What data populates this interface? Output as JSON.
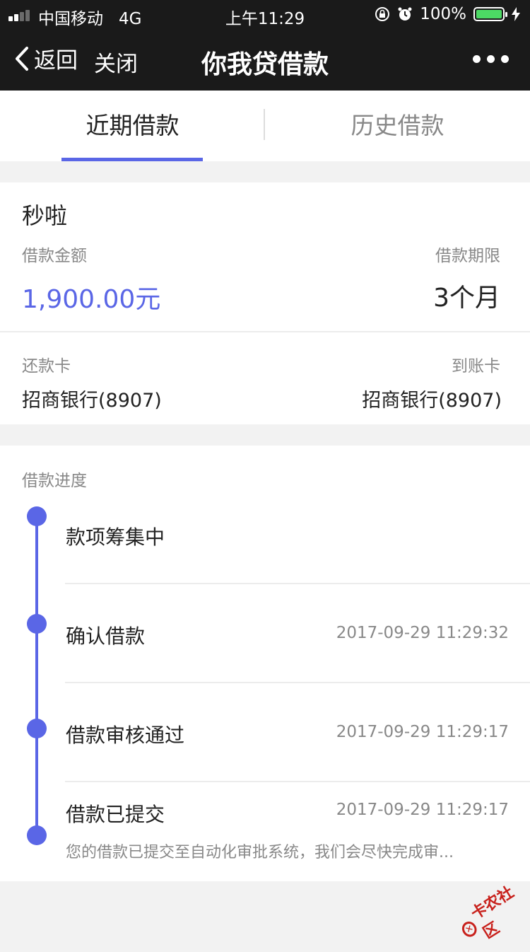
{
  "status_bar": {
    "carrier": "中国移动",
    "network": "4G",
    "time": "上午11:29",
    "battery": "100%",
    "battery_level": 1.0
  },
  "nav": {
    "back_label": "返回",
    "close_label": "关闭",
    "title": "你我贷借款"
  },
  "tabs": [
    {
      "label": "近期借款",
      "active": true
    },
    {
      "label": "历史借款",
      "active": false
    }
  ],
  "loan": {
    "name": "秒啦",
    "amount_label": "借款金额",
    "amount": "1,900.00元",
    "term_label": "借款期限",
    "term": "3个月",
    "repay_card_label": "还款卡",
    "repay_card": "招商银行(8907)",
    "receive_card_label": "到账卡",
    "receive_card": "招商银行(8907)"
  },
  "progress": {
    "title": "借款进度",
    "steps": [
      {
        "title": "款项筹集中",
        "time": ""
      },
      {
        "title": "确认借款",
        "time": "2017-09-29 11:29:32"
      },
      {
        "title": "借款审核通过",
        "time": "2017-09-29 11:29:17"
      },
      {
        "title": "借款已提交",
        "time": "2017-09-29 11:29:17",
        "desc": "您的借款已提交至自动化审批系统，我们会尽快完成审..."
      }
    ]
  },
  "watermark": "卡农社区",
  "colors": {
    "accent": "#5a66e6",
    "nav_bg": "#1a1a1a",
    "battery": "#4cd964",
    "watermark": "#c8211c"
  }
}
